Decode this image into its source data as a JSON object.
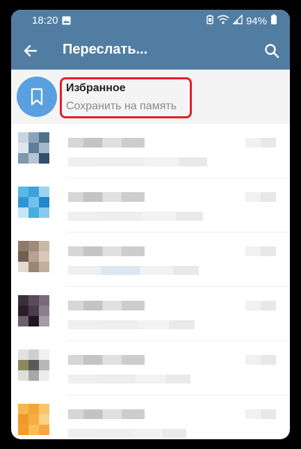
{
  "status_bar": {
    "time": "18:20",
    "battery": "94%"
  },
  "toolbar": {
    "title": "Переслать..."
  },
  "saved": {
    "title": "Избранное",
    "subtitle": "Сохранить на память"
  },
  "colors": {
    "header": "#527da3",
    "saved_avatar": "#5aa0e0",
    "highlight": "#e41e26"
  },
  "icons": {
    "back": "arrow-left",
    "search": "magnifier",
    "saved": "bookmark",
    "gallery": "image",
    "battery": "battery-saver",
    "wifi": "wifi",
    "signal": "cellular-signal"
  },
  "chats": [
    {
      "name": "",
      "message": ""
    },
    {
      "name": "",
      "message": ""
    },
    {
      "name": "",
      "message": ""
    },
    {
      "name": "",
      "message": ""
    },
    {
      "name": "",
      "message": ""
    },
    {
      "name": "",
      "message": ""
    }
  ]
}
